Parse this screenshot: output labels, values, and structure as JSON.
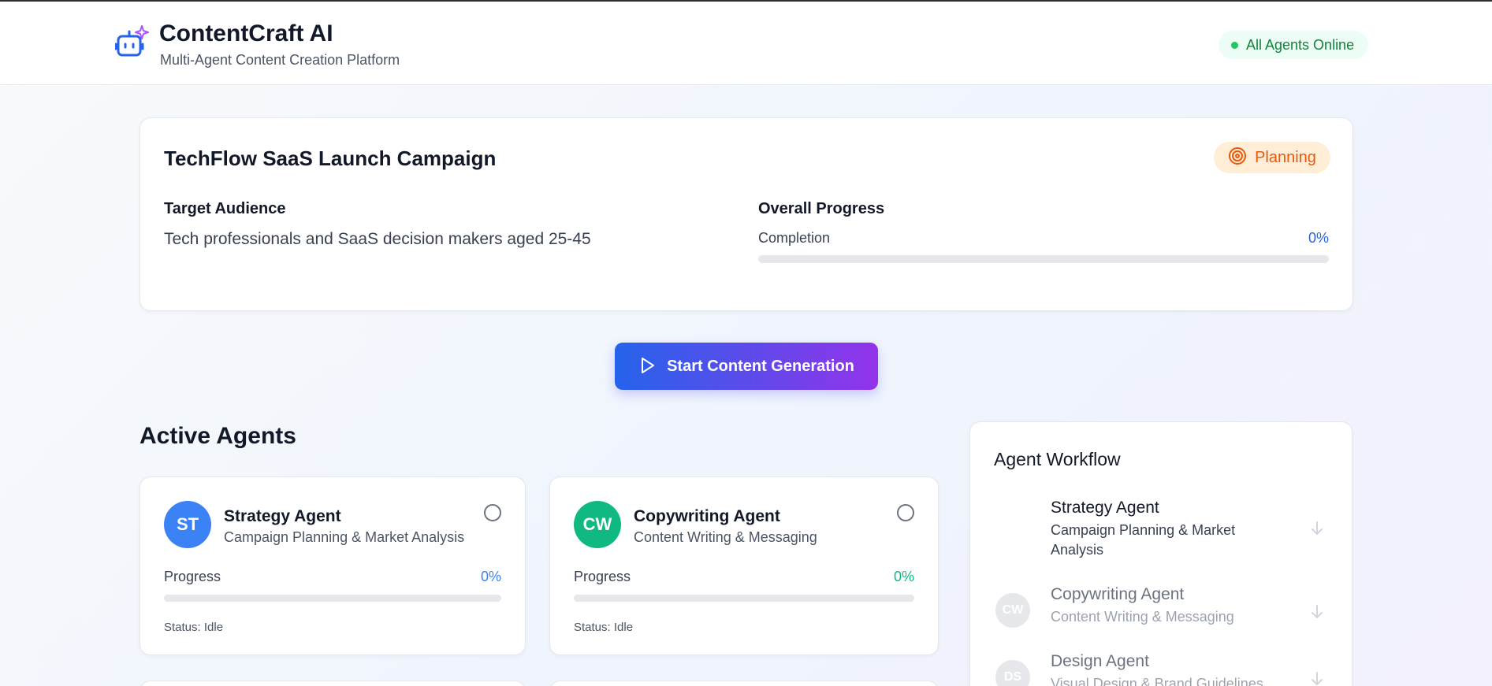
{
  "header": {
    "app_title": "ContentCraft AI",
    "app_subtitle": "Multi-Agent Content Creation Platform",
    "status_text": "All Agents Online",
    "logo_icon": "bot-sparkle-icon"
  },
  "campaign": {
    "title": "TechFlow SaaS Launch Campaign",
    "phase_label": "Planning",
    "phase_icon": "target-icon",
    "audience_title": "Target Audience",
    "audience_text": "Tech professionals and SaaS decision makers aged 25-45",
    "progress_title": "Overall Progress",
    "progress_label": "Completion",
    "progress_value": "0%",
    "progress_fraction": 0
  },
  "actions": {
    "start_label": "Start Content Generation",
    "start_icon": "play-icon"
  },
  "agents_section": {
    "title": "Active Agents",
    "agents": [
      {
        "initials": "ST",
        "name": "Strategy Agent",
        "role": "Campaign Planning & Market Analysis",
        "progress_label": "Progress",
        "progress_value": "0%",
        "progress_fraction": 0,
        "status": "Status: Idle",
        "color": "#3b82f6"
      },
      {
        "initials": "CW",
        "name": "Copywriting Agent",
        "role": "Content Writing & Messaging",
        "progress_label": "Progress",
        "progress_value": "0%",
        "progress_fraction": 0,
        "status": "Status: Idle",
        "color": "#10b981"
      }
    ]
  },
  "workflow": {
    "title": "Agent Workflow",
    "items": [
      {
        "initials": "",
        "name": "Strategy Agent",
        "desc": "Campaign Planning & Market Analysis",
        "arrow_icon": "arrow-down-icon"
      },
      {
        "initials": "CW",
        "name": "Copywriting Agent",
        "desc": "Content Writing & Messaging",
        "arrow_icon": "arrow-down-icon"
      },
      {
        "initials": "DS",
        "name": "Design Agent",
        "desc": "Visual Design & Brand Guidelines",
        "arrow_icon": "arrow-down-icon"
      }
    ]
  },
  "colors": {
    "accent": "#2563eb",
    "accent_purple": "#9333ea",
    "online": "#22c55e",
    "planning": "#ea580c"
  }
}
